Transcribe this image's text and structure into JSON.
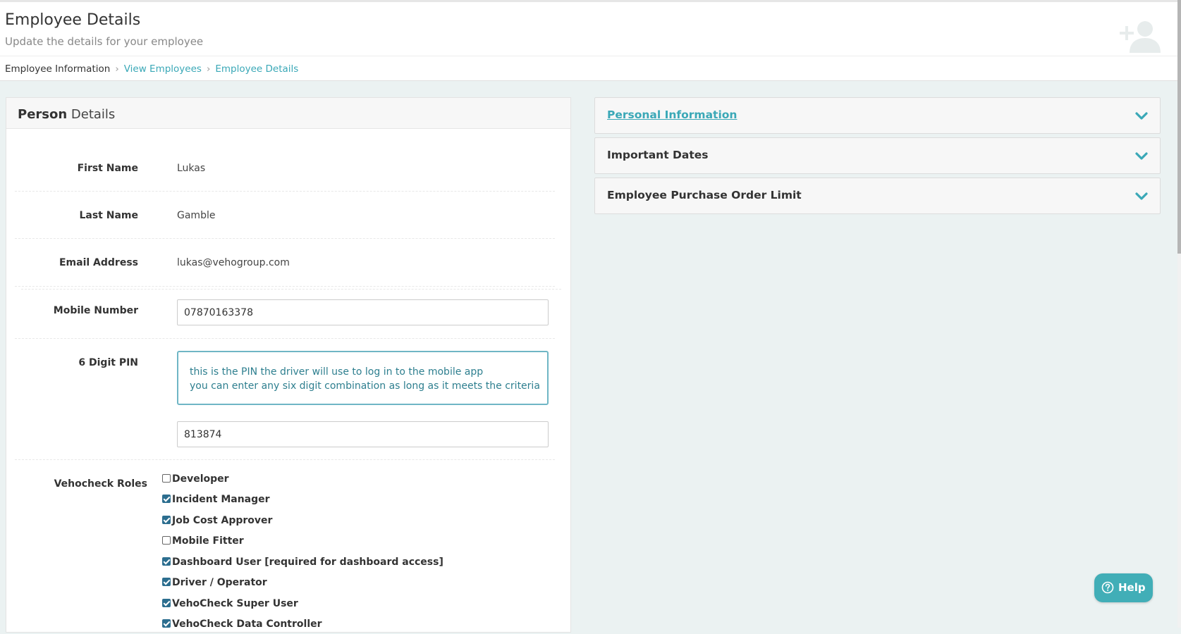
{
  "header": {
    "title": "Employee Details",
    "subtitle": "Update the details for your employee",
    "icon": "add-user-icon"
  },
  "breadcrumb": [
    {
      "label": "Employee Information"
    },
    {
      "label": "View Employees"
    },
    {
      "label": "Employee Details"
    }
  ],
  "card": {
    "title_strong": "Person",
    "title_light": "Details"
  },
  "fields": {
    "first_name": {
      "label": "First Name",
      "value": "Lukas"
    },
    "last_name": {
      "label": "Last Name",
      "value": "Gamble"
    },
    "email": {
      "label": "Email Address",
      "value": "lukas@vehogroup.com"
    },
    "mobile": {
      "label": "Mobile Number",
      "value": "07870163378"
    },
    "pin": {
      "label": "6 Digit PIN",
      "info_line1": "this is the PIN the driver will use to log in to the mobile app",
      "info_line2": "you can enter any six digit combination as long as it meets the criteria",
      "value": "813874"
    }
  },
  "roles": {
    "label": "Vehocheck Roles",
    "items": [
      {
        "label": "Developer",
        "checked": false
      },
      {
        "label": "Incident Manager",
        "checked": true
      },
      {
        "label": "Job Cost Approver",
        "checked": true
      },
      {
        "label": "Mobile Fitter",
        "checked": false
      },
      {
        "label": "Dashboard User [required for dashboard access]",
        "checked": true
      },
      {
        "label": "Driver / Operator",
        "checked": true
      },
      {
        "label": "VehoCheck Super User",
        "checked": true
      },
      {
        "label": "VehoCheck Data Controller",
        "checked": true
      }
    ]
  },
  "accordion": [
    {
      "title": "Personal Information",
      "active": true
    },
    {
      "title": "Important Dates",
      "active": false
    },
    {
      "title": "Employee Purchase Order Limit",
      "active": false
    }
  ],
  "help": {
    "label": "Help"
  },
  "colors": {
    "accent": "#3aa8b7",
    "help_bg": "#41aeb7",
    "page_bg": "#ebf2f2"
  }
}
